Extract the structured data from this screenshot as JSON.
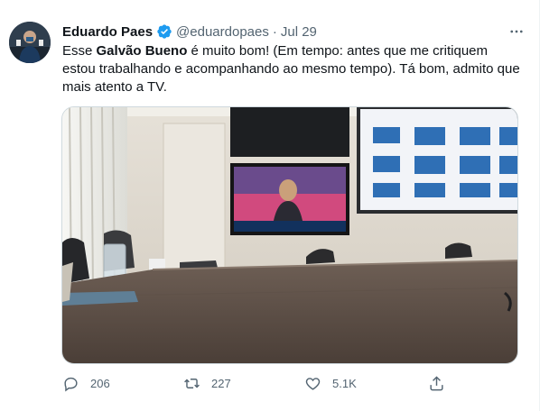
{
  "tweet": {
    "author_name": "Eduardo Paes",
    "handle": "@eduardopaes",
    "separator": "·",
    "date": "Jul 29",
    "text_part1": "Esse ",
    "text_bold": "Galvão Bueno",
    "text_part2": " é muito bom!  (Em tempo: antes que me critiquem estou trabalhando e acompanhando ao mesmo tempo).  Tá bom, admito que mais atento a TV.",
    "verified_icon": "verified-badge-icon",
    "verified_color": "#1d9bf0"
  },
  "actions": {
    "reply_count": "206",
    "retweet_count": "227",
    "like_count": "5.1K"
  },
  "colors": {
    "text": "#0f1419",
    "secondary": "#536471",
    "border": "#cfd9de"
  }
}
